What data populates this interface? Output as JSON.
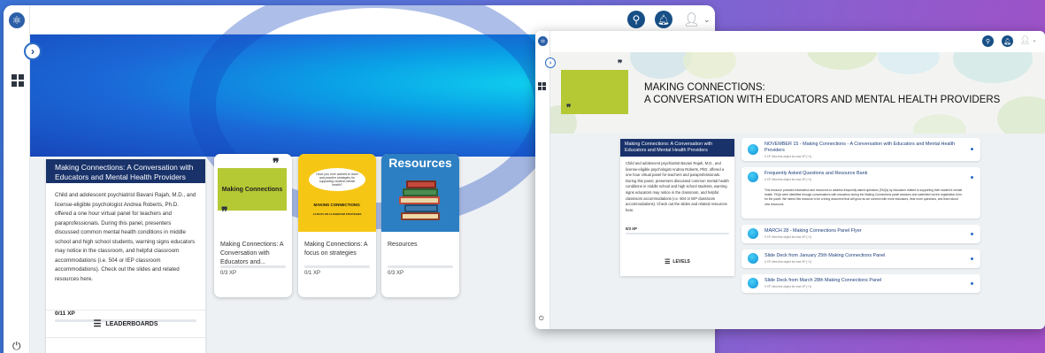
{
  "back_window": {
    "panel": {
      "title": "Making Connections: A Conversation with Educators and Mental Health Providers",
      "description": "Child and adolescent psychiatrist Bavani Rajah, M.D., and license-eligible psychologist Andrea Roberts, Ph.D. offered a one hour virtual panel for teachers and paraprofessionals. During this panel, presenters discussed common mental health conditions in middle school and high school students, warning signs educators may notice in the classroom, and helpful classroom accommodations (i.e. 504 or IEP classroom accommodations). Check out the slides and related resources here.",
      "xp": "0/11 XP",
      "xp_progress": 0,
      "leaderboards_label": "LEADERBOARDS"
    },
    "cards": [
      {
        "image_text": "Making Connections",
        "title": "Making Connections: A Conversation with Educators and...",
        "xp": "0/3 XP",
        "xp_progress": 0
      },
      {
        "image_quote": "Have you ever wanted to learn and practice strategies for supporting student mental health?",
        "image_title": "MAKING CONNECTIONS:",
        "image_subtitle": "A FOCUS ON CLASSROOM STRATEGIES",
        "title": "Making Connections: A focus on strategies",
        "xp": "0/1 XP",
        "xp_progress": 0
      },
      {
        "image_text": "Resources",
        "title": "Resources",
        "xp": "0/3 XP",
        "xp_progress": 0
      }
    ]
  },
  "front_window": {
    "banner": {
      "line1": "MAKING CONNECTIONS:",
      "line2": "A CONVERSATION WITH EDUCATORS AND MENTAL HEALTH PROVIDERS"
    },
    "panel": {
      "title": "Making Connections: A Conversation with Educators and Mental Health Providers",
      "description": "Child and adolescent psychiatrist Bavani Rajah, M.D., and license-eligible psychologist Andrea Roberts, PhD. offered a one hour virtual panel for teachers and paraprofessionals. During this panel, presenters discussed common mental health conditions in middle school and high school students, warning signs educators may notice in the classroom, and helpful classroom accommodations (i.e. 504 or IEP classroom accommodations). Check out the slides and related resources here.",
      "xp": "0/3 XP",
      "xp_progress": 0,
      "levels_label": "LEVELS"
    },
    "resources": [
      {
        "title": "NOVEMBER 15 - Making Connections - A Conversation with Educators and Mental Health Providers",
        "sub": "0 XP View this object for max XP (+1)"
      },
      {
        "title": "Frequently Asked Questions and Resource Bank",
        "sub": "0 XP View this object for max XP (+1)",
        "description": "This resource provides information and resources to address frequently asked questions (FAQs) by educators related to supporting their student's mental health. FAQs were identified through conversations with educators during the Making Connections panel sessions and submitted via the registration form for the panel. We intend this resource to be a living document that will grow as we connect with more educators, hear more questions, and learn about new resources."
      },
      {
        "title": "MARCH 28 - Making Connections Panel Flyer",
        "sub": "0 XP View this object for max XP (+1)"
      },
      {
        "title": "Slide Deck from January 25th Making Connections Panel",
        "sub": "0 XP View this object for max XP (+1)"
      },
      {
        "title": "Slide Deck from March 28th Making Connections Panel",
        "sub": "0 XP View this object for max XP (+1)"
      }
    ]
  },
  "colors": {
    "navy": "#19326a",
    "accent_blue": "#174f86",
    "lime": "#b5c934",
    "yellow": "#f6c615",
    "resources_blue": "#2c7fc2"
  },
  "icons": {
    "logo": "atom-logo-icon",
    "search": "search-icon",
    "bell": "bell-icon",
    "avatar": "user-icon",
    "expand": "chevron-right-icon",
    "dashboard": "dashboard-icon",
    "power": "power-icon",
    "list": "list-icon"
  }
}
